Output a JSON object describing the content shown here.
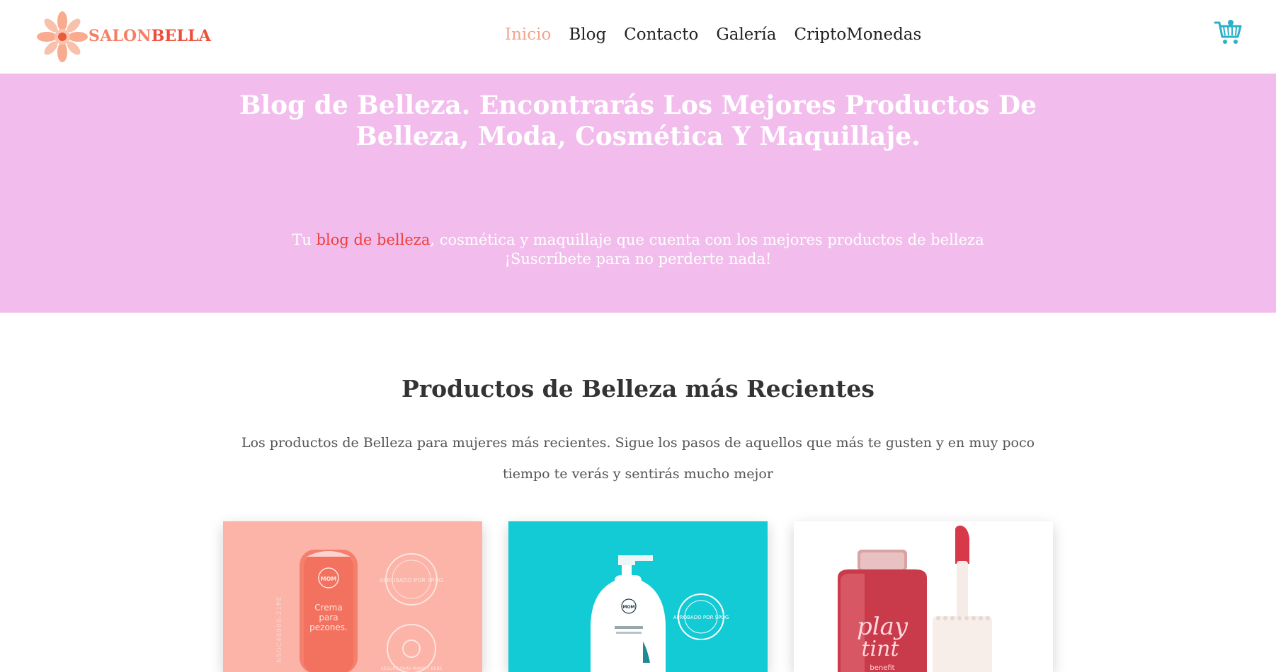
{
  "header": {
    "brand_part1": "SALON",
    "brand_part2": "BELLA",
    "nav": [
      {
        "label": "Inicio",
        "active": true
      },
      {
        "label": "Blog",
        "active": false
      },
      {
        "label": "Contacto",
        "active": false
      },
      {
        "label": "Galería",
        "active": false
      },
      {
        "label": "CriptoMonedas",
        "active": false
      }
    ],
    "icons": {
      "logo": "flower-logo-icon",
      "cart": "shopping-cart-icon"
    }
  },
  "hero": {
    "title": "Blog de Belleza. Encontrarás Los Mejores Productos De Belleza, Moda, Cosmética Y Maquillaje.",
    "subtitle_prefix": "Tu ",
    "subtitle_link": "blog de belleza",
    "subtitle_rest": ", cosmética y maquillaje que cuenta con los mejores productos de belleza",
    "subtitle_line2": "¡Suscríbete para no perderte nada!"
  },
  "recent": {
    "title": "Productos de Belleza más Recientes",
    "description": "Los productos de Belleza para mujeres más recientes. Sigue los pasos de aquellos que más te gusten y en muy poco tiempo te verás y sentirás mucho mejor"
  },
  "products": [
    {
      "brand": "MOM",
      "name_line1": "Crema",
      "name_line2": "para",
      "name_line3": "pezones.",
      "badge_top": "APROBADO POR SPOG",
      "badge_bottom": "SEGURO PARA MAMÁ Y BEBE"
    },
    {
      "brand": "MOM",
      "badge": "APROBADO POR SPOG"
    },
    {
      "brand_line1": "play",
      "brand_line2": "tint",
      "maker": "benefit"
    }
  ],
  "colors": {
    "hero_bg": "#f2bdec",
    "accent": "#ec4e3a",
    "nav_active": "#f3a58e",
    "card1_bg": "#fcb3a8",
    "card2_bg": "#13cbd4",
    "cart": "#2ab0c8"
  }
}
